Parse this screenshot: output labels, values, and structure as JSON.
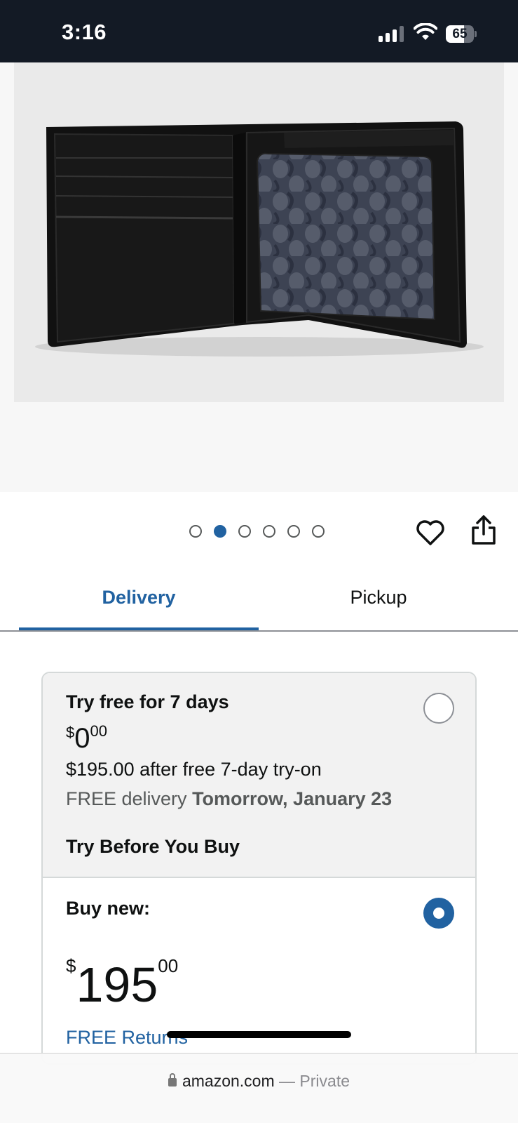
{
  "status_bar": {
    "time": "3:16",
    "battery_percent": 65,
    "battery_label": "65"
  },
  "carousel": {
    "total_images": 6,
    "active_index": 1
  },
  "tabs": {
    "delivery": "Delivery",
    "pickup": "Pickup",
    "active": "Delivery"
  },
  "try_offer": {
    "title": "Try free for 7 days",
    "price_symbol": "$",
    "price_whole": "0",
    "price_fraction": "00",
    "after_text": "$195.00 after free 7-day try-on",
    "delivery_prefix": "FREE delivery",
    "delivery_date": "Tomorrow, January 23",
    "program_label": "Try Before You Buy",
    "selected": false
  },
  "buy_offer": {
    "title": "Buy new:",
    "price_symbol": "$",
    "price_whole": "195",
    "price_fraction": "00",
    "returns_link": "FREE Returns",
    "selected": true
  },
  "browser": {
    "domain": "amazon.com",
    "separator": " — ",
    "mode": "Private"
  },
  "colors": {
    "accent_blue": "#2162a1",
    "status_bar_bg": "#131a25",
    "try_card_bg": "#f2f2f2"
  }
}
